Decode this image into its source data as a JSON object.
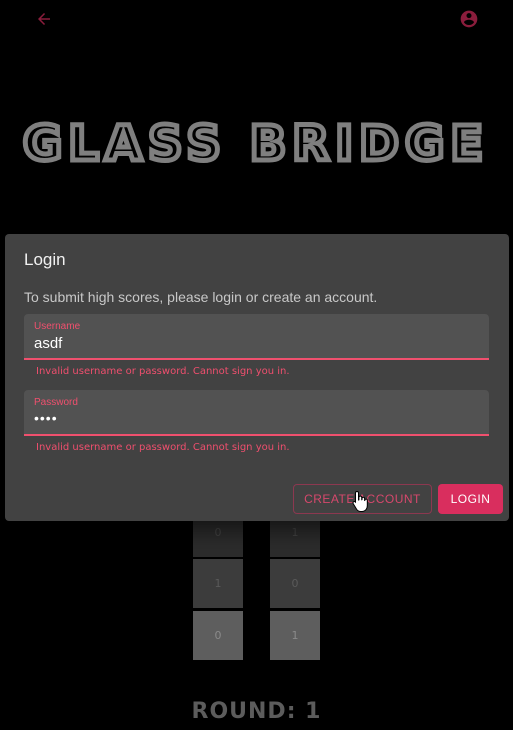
{
  "colors": {
    "accent": "#d92e5e",
    "error": "#ef4f6e",
    "dialog_bg": "#424242",
    "field_bg": "#525252",
    "title_gray": "#7f7f7f"
  },
  "topbar": {
    "back_icon": "arrow-left-icon",
    "account_icon": "account-circle-icon"
  },
  "game": {
    "title": "GLASS BRIDGE",
    "round_label": "ROUND: 1",
    "tiles": {
      "left_column": [
        "0",
        "1",
        "0"
      ],
      "right_column": [
        "1",
        "0",
        "1"
      ]
    }
  },
  "dialog": {
    "title": "Login",
    "text": "To submit high scores, please login or create an account.",
    "username": {
      "label": "Username",
      "value": "asdf",
      "error": "Invalid username or password. Cannot sign you in."
    },
    "password": {
      "label": "Password",
      "value": "••••",
      "error": "Invalid username or password. Cannot sign you in."
    },
    "create_account_label": "CREATE ACCOUNT",
    "login_label": "LOGIN"
  }
}
